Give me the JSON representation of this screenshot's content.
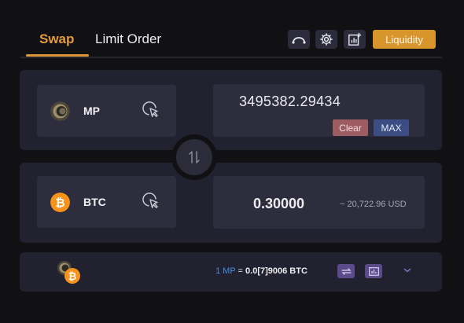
{
  "tabs": [
    {
      "label": "Swap",
      "active": true
    },
    {
      "label": "Limit Order",
      "active": false
    }
  ],
  "toolbar": {
    "icons": [
      "route-icon",
      "gear-icon",
      "chart-add-icon"
    ],
    "liquidity_label": "Liquidity"
  },
  "from": {
    "token": "MP",
    "amount": "3495382.29434",
    "clear_label": "Clear",
    "max_label": "MAX"
  },
  "to": {
    "token": "BTC",
    "amount": "0.30000",
    "usd_value": "~ 20,722.96 USD"
  },
  "rate": {
    "lhs": "1 MP",
    "eq": " = ",
    "rhs": "0.0[7]9006 BTC"
  },
  "colors": {
    "accent": "#d8952c",
    "panel": "#212130",
    "field": "#2d2d3d",
    "blue": "#4a8de0",
    "clear": "#9c5c62",
    "max": "#3c4d84",
    "btc": "#f7931a"
  }
}
